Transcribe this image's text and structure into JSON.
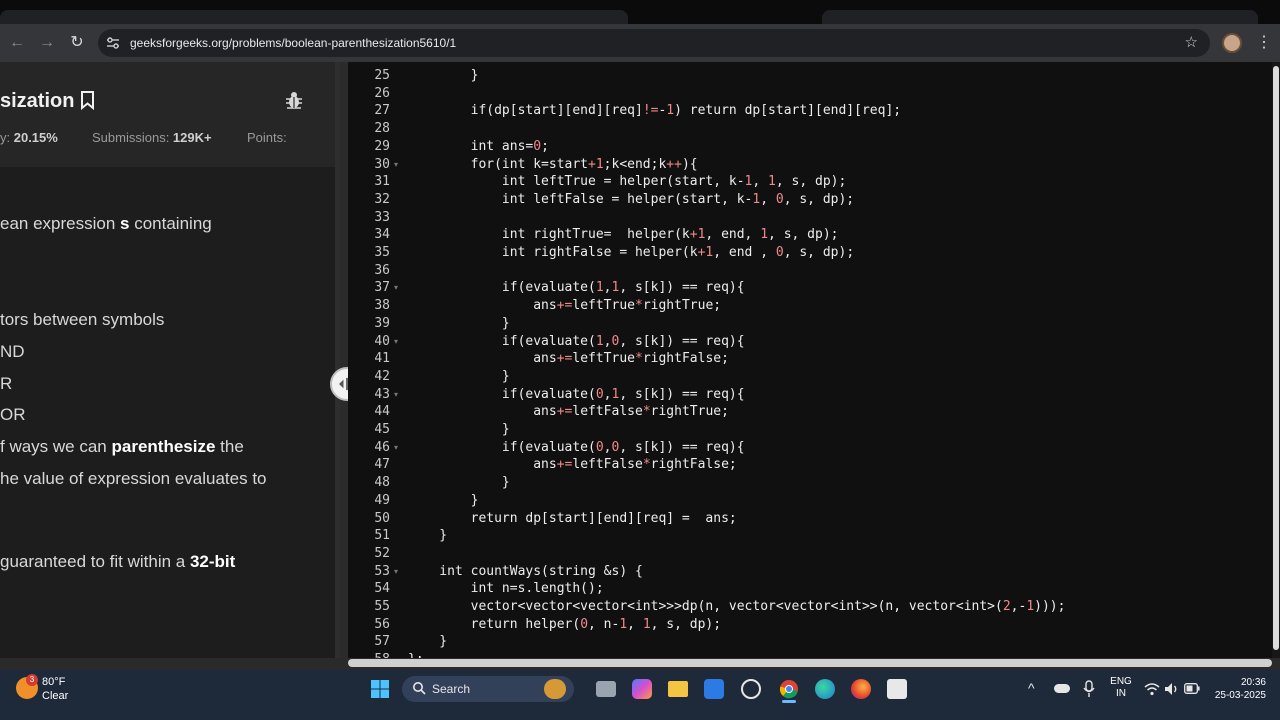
{
  "browser": {
    "url": "geeksforgeeks.org/problems/boolean-parenthesization5610/1",
    "back_icon": "arrow-left-icon",
    "forward_icon": "arrow-right-icon",
    "reload_icon": "reload-icon",
    "star_glyph": "☆",
    "kebab_glyph": "⋮"
  },
  "problem": {
    "title": "sization",
    "accuracy_label": "y: ",
    "accuracy_value": "20.15%",
    "submissions_label": "Submissions: ",
    "submissions_value": "129K+",
    "points_label": "Points:",
    "desc": {
      "l1_a": "ean expression ",
      "l1_b": "s",
      "l1_c": " containing",
      "l2": "tors between symbols",
      "l3": "ND",
      "l4": "R",
      "l5": "OR",
      "l6_a": "f ways we can ",
      "l6_b": "parenthesize",
      "l6_c": " the",
      "l7": "he value of expression evaluates to",
      "l8_a": " guaranteed to fit within a ",
      "l8_b": "32-bit"
    }
  },
  "editor": {
    "lines": [
      {
        "n": "25",
        "code": "        }",
        "fold": ""
      },
      {
        "n": "26",
        "code": "",
        "fold": ""
      },
      {
        "n": "27",
        "code": "        if(dp[start][end][req]!=-1) return dp[start][end][req];",
        "fold": ""
      },
      {
        "n": "28",
        "code": "",
        "fold": ""
      },
      {
        "n": "29",
        "code": "        int ans=0;",
        "fold": ""
      },
      {
        "n": "30",
        "code": "        for(int k=start+1;k<end;k++){",
        "fold": "▾"
      },
      {
        "n": "31",
        "code": "            int leftTrue = helper(start, k-1, 1, s, dp);",
        "fold": ""
      },
      {
        "n": "32",
        "code": "            int leftFalse = helper(start, k-1, 0, s, dp);",
        "fold": ""
      },
      {
        "n": "33",
        "code": "",
        "fold": ""
      },
      {
        "n": "34",
        "code": "            int rightTrue=  helper(k+1, end, 1, s, dp);",
        "fold": ""
      },
      {
        "n": "35",
        "code": "            int rightFalse = helper(k+1, end , 0, s, dp);",
        "fold": ""
      },
      {
        "n": "36",
        "code": "",
        "fold": ""
      },
      {
        "n": "37",
        "code": "            if(evaluate(1,1, s[k]) == req){",
        "fold": "▾"
      },
      {
        "n": "38",
        "code": "                ans+=leftTrue*rightTrue;",
        "fold": ""
      },
      {
        "n": "39",
        "code": "            }",
        "fold": ""
      },
      {
        "n": "40",
        "code": "            if(evaluate(1,0, s[k]) == req){",
        "fold": "▾"
      },
      {
        "n": "41",
        "code": "                ans+=leftTrue*rightFalse;",
        "fold": ""
      },
      {
        "n": "42",
        "code": "            }",
        "fold": ""
      },
      {
        "n": "43",
        "code": "            if(evaluate(0,1, s[k]) == req){",
        "fold": "▾"
      },
      {
        "n": "44",
        "code": "                ans+=leftFalse*rightTrue;",
        "fold": ""
      },
      {
        "n": "45",
        "code": "            }",
        "fold": ""
      },
      {
        "n": "46",
        "code": "            if(evaluate(0,0, s[k]) == req){",
        "fold": "▾"
      },
      {
        "n": "47",
        "code": "                ans+=leftFalse*rightFalse;",
        "fold": ""
      },
      {
        "n": "48",
        "code": "            }",
        "fold": ""
      },
      {
        "n": "49",
        "code": "        }",
        "fold": ""
      },
      {
        "n": "50",
        "code": "        return dp[start][end][req] =  ans;",
        "fold": ""
      },
      {
        "n": "51",
        "code": "    }",
        "fold": ""
      },
      {
        "n": "52",
        "code": "",
        "fold": ""
      },
      {
        "n": "53",
        "code": "    int countWays(string &s) {",
        "fold": "▾"
      },
      {
        "n": "54",
        "code": "        int n=s.length();",
        "fold": ""
      },
      {
        "n": "55",
        "code": "        vector<vector<vector<int>>>dp(n, vector<vector<int>>(n, vector<int>(2,-1)));",
        "fold": ""
      },
      {
        "n": "56",
        "code": "        return helper(0, n-1, 1, s, dp);",
        "fold": ""
      },
      {
        "n": "57",
        "code": "    }",
        "fold": ""
      },
      {
        "n": "58",
        "code": "};",
        "fold": ""
      }
    ]
  },
  "taskbar": {
    "weather_temp": "80°F",
    "weather_cond": "Clear",
    "weather_badge": "3",
    "search_label": "Search",
    "lang_1": "ENG",
    "lang_2": "IN",
    "time": "20:36",
    "date": "25-03-2025",
    "chevron_glyph": "^"
  },
  "colors": {
    "accent_blue": "#6fb6ff",
    "editor_bg": "#101010",
    "number_literal": "#f08a8a"
  }
}
